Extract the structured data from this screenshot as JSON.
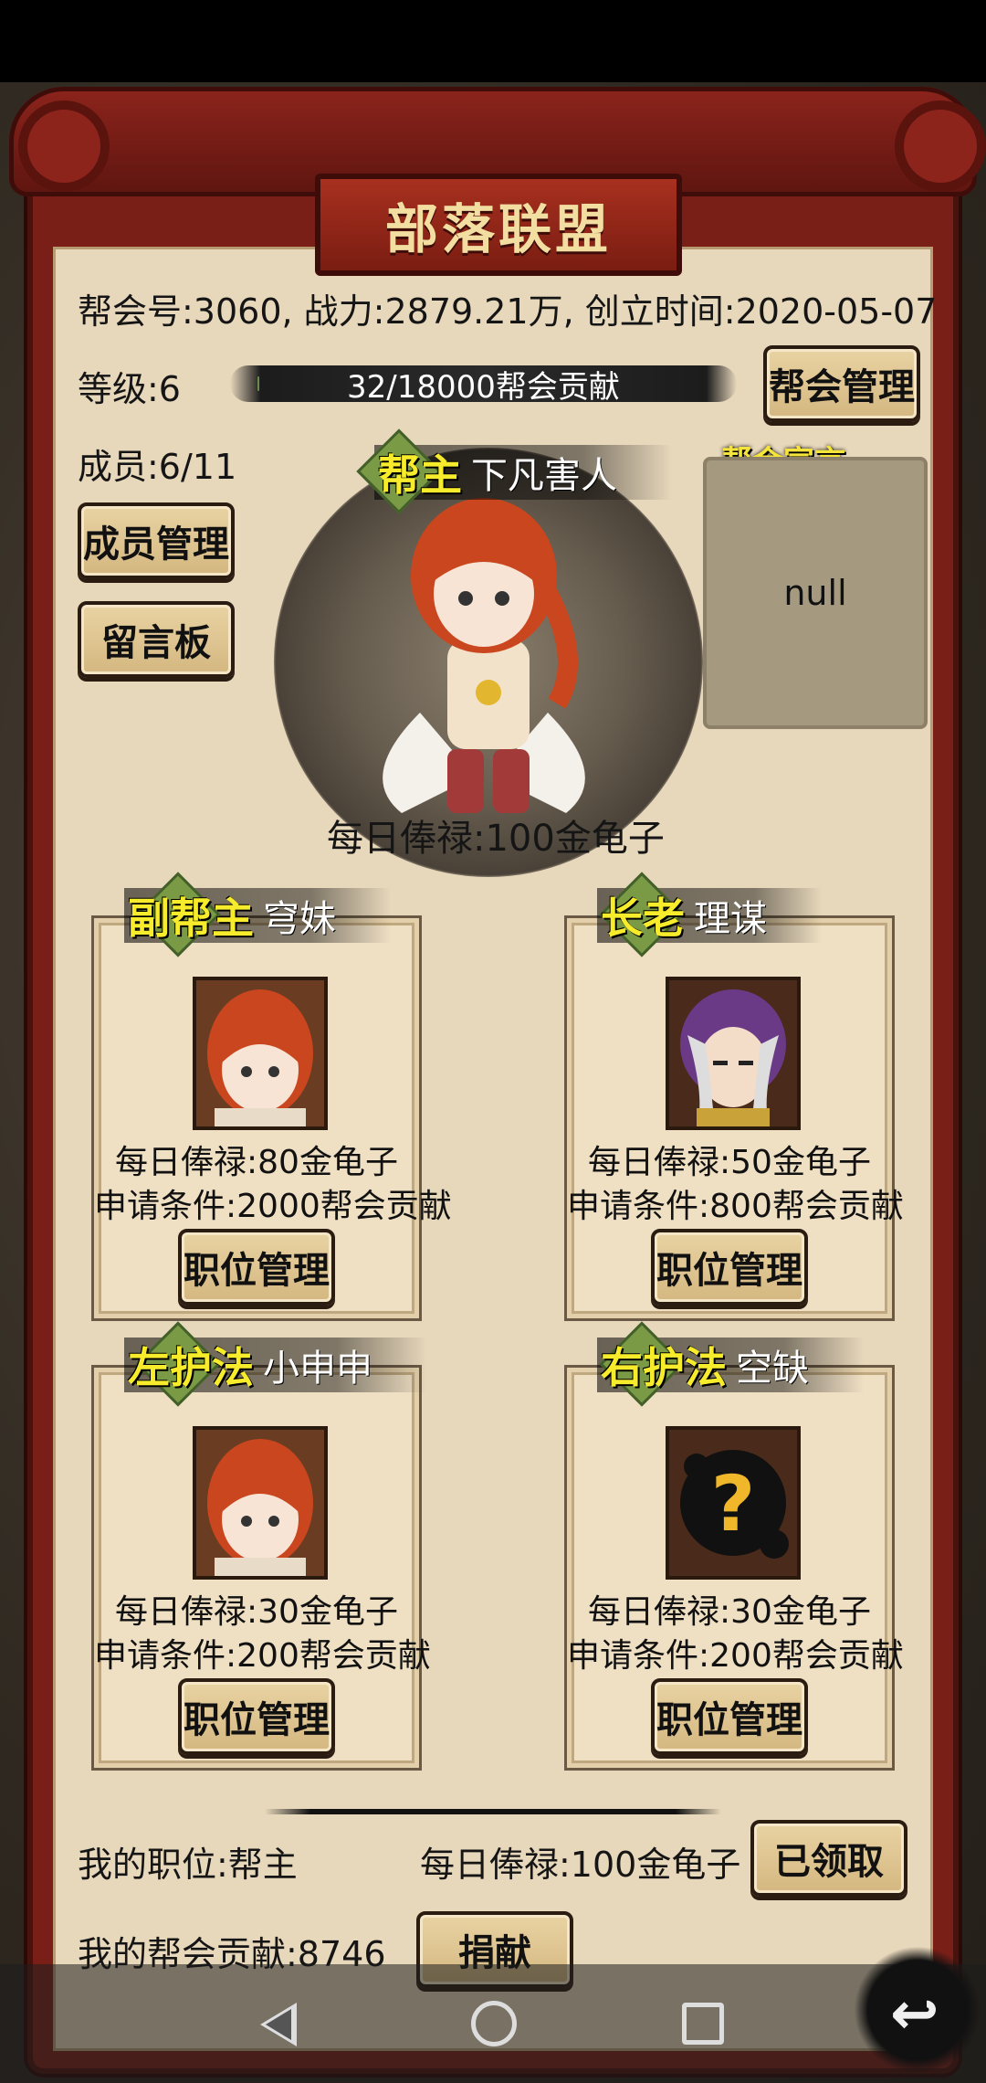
{
  "title": "部落联盟",
  "guild": {
    "info_line": "帮会号:3060, 战力:2879.21万, 创立时间:2020-05-07",
    "level_label": "等级:6",
    "progress_text": "32/18000帮会贡献",
    "progress_fraction": 0.0018,
    "members_label": "成员:6/11"
  },
  "buttons": {
    "guild_manage": "帮会管理",
    "member_manage": "成员管理",
    "message_board": "留言板",
    "position_manage": "职位管理",
    "claimed": "已领取",
    "donate": "捐献"
  },
  "announcement": {
    "title": "帮会宣言",
    "content": "null"
  },
  "leader": {
    "role": "帮主",
    "name": "下凡害人",
    "salary": "每日俸禄:100金龟子"
  },
  "positions": [
    {
      "role": "副帮主",
      "name": "穹妹",
      "salary": "每日俸禄:80金龟子",
      "requirement": "申请条件:2000帮会贡献",
      "portrait": "red-hair-girl"
    },
    {
      "role": "长老",
      "name": "理谋",
      "salary": "每日俸禄:50金龟子",
      "requirement": "申请条件:800帮会贡献",
      "portrait": "purple-hair-man"
    },
    {
      "role": "左护法",
      "name": "小申申",
      "salary": "每日俸禄:30金龟子",
      "requirement": "申请条件:200帮会贡献",
      "portrait": "red-hair-girl"
    },
    {
      "role": "右护法",
      "name": "空缺",
      "salary": "每日俸禄:30金龟子",
      "requirement": "申请条件:200帮会贡献",
      "portrait": "question-mark"
    }
  ],
  "footer": {
    "my_position": "我的职位:帮主",
    "my_salary": "每日俸禄:100金龟子",
    "my_contribution": "我的帮会贡献:8746"
  },
  "colors": {
    "frame": "#7a1f18",
    "panel": "#e7d7bb",
    "role_yellow": "#f7ec2c"
  }
}
